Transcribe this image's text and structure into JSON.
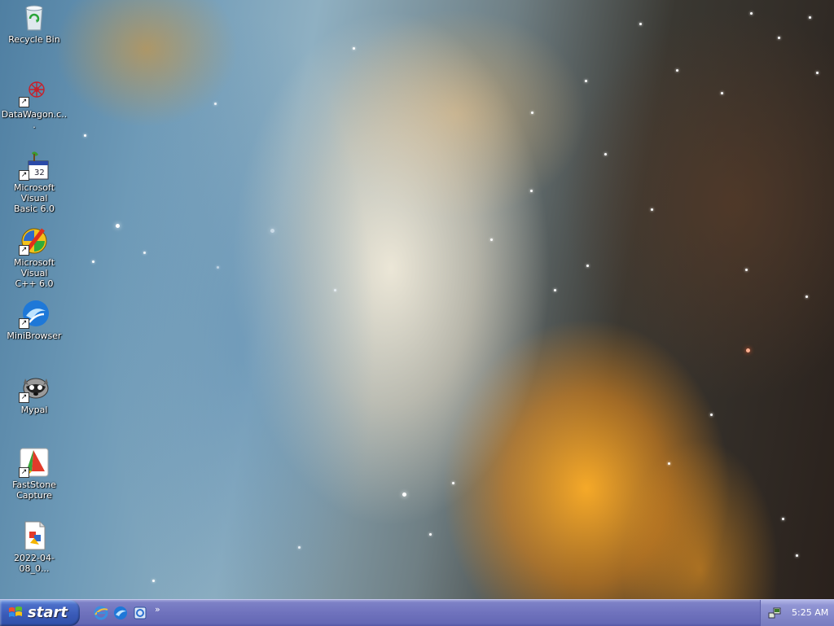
{
  "desktop": {
    "icons": [
      {
        "label": "Recycle Bin",
        "icon": "recycle-bin-icon"
      },
      {
        "label": "DataWagon.c...",
        "icon": "datawagon-icon"
      },
      {
        "label": "Microsoft Visual\nBasic 6.0",
        "icon": "visual-basic-icon"
      },
      {
        "label": "Microsoft Visual\nC++ 6.0",
        "icon": "visual-cpp-icon"
      },
      {
        "label": "MiniBrowser",
        "icon": "minibrowser-icon"
      },
      {
        "label": "Mypal",
        "icon": "mypal-icon"
      },
      {
        "label": "FastStone\nCapture",
        "icon": "faststone-capture-icon"
      },
      {
        "label": "2022-04-08_0...",
        "icon": "image-file-icon"
      }
    ]
  },
  "taskbar": {
    "start_label": "start",
    "quick_launch": [
      "internet-explorer-icon",
      "minibrowser-icon",
      "show-desktop-icon"
    ],
    "chevron": "»",
    "clock": "5:25 AM",
    "tray_icons": [
      "network-icon"
    ]
  },
  "colors": {
    "taskbar": "#6f72bd",
    "start_button": "#3a5bb8",
    "tray": "#8488ca"
  }
}
